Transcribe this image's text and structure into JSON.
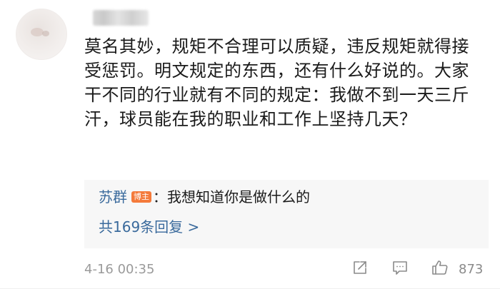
{
  "comment": {
    "text": "莫名其妙，规矩不合理可以质疑，违反规矩就得接受惩罚。明文规定的东西，还有什么好说的。大家干不同的行业就有不同的规定：我做不到一天三斤汗，球员能在我的职业和工作上坚持几天？",
    "timestamp": "4-16 00:35",
    "like_count": "873"
  },
  "reply": {
    "author": "苏群",
    "badge": "博主",
    "separator": "：",
    "text": "我想知道你是做什么的",
    "view_more": "共169条回复 >"
  },
  "icons": {
    "share": "share-icon",
    "comment": "comment-icon",
    "like": "thumbs-up-icon"
  },
  "colors": {
    "link": "#3a6a9c",
    "badge": "#f47a3a",
    "meta": "#9a9a9a"
  }
}
